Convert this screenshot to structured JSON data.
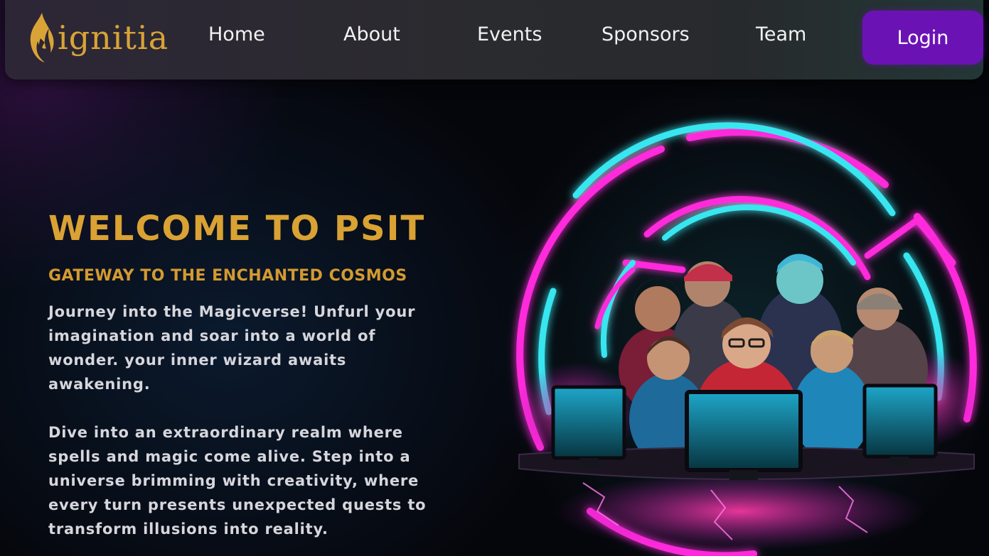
{
  "nav": {
    "logo_text": "ignitia",
    "logo_icon": "flame-icon",
    "links": [
      "Home",
      "About",
      "Events",
      "Sponsors",
      "Team"
    ],
    "login_label": "Login"
  },
  "hero": {
    "title": "WELCOME TO PSIT",
    "subtitle": "GATEWAY TO THE ENCHANTED COSMOS",
    "paragraph1": "Journey into the Magicverse! Unfurl your imagination and soar into a world of wonder. your inner wizard awaits awakening.",
    "paragraph2": "Dive into an extraordinary realm where spells and magic come alive. Step into a universe brimming with creativity, where every turn presents unexpected quests to transform illusions into reality."
  },
  "colors": {
    "accent_gold": "#d9a233",
    "login_purple": "#6b12b5",
    "neon_magenta": "#ff2bdc",
    "neon_cyan": "#39e6f0"
  }
}
